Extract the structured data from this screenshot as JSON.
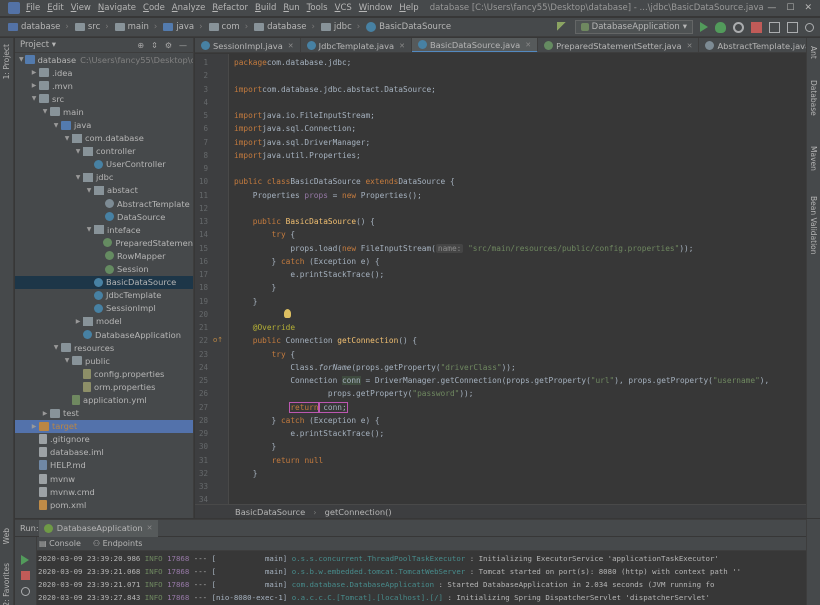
{
  "menubar": {
    "app_icon": "intellij-icon",
    "items": [
      "File",
      "Edit",
      "View",
      "Navigate",
      "Code",
      "Analyze",
      "Refactor",
      "Build",
      "Run",
      "Tools",
      "VCS",
      "Window",
      "Help"
    ],
    "window_title": "database [C:\\Users\\fancy55\\Desktop\\database] - ...\\jdbc\\BasicDataSource.java"
  },
  "navbar": {
    "crumbs": [
      "database",
      "src",
      "main",
      "java",
      "com",
      "database",
      "jdbc",
      "BasicDataSource"
    ],
    "run_config": "DatabaseApplication"
  },
  "left_strip": {
    "top_tab": "1: Project",
    "web_tab": "Web",
    "favorites_tab": "2: Favorites"
  },
  "right_strip": {
    "tabs": [
      "Ant",
      "Database",
      "Maven",
      "Bean Validation"
    ]
  },
  "project": {
    "title": "Project",
    "rows": [
      {
        "indent": 0,
        "arrow": "▼",
        "icon": "folder-blue",
        "label": "database",
        "hint": "C:\\Users\\fancy55\\Desktop\\d"
      },
      {
        "indent": 1,
        "arrow": "▶",
        "icon": "folder",
        "label": ".idea",
        "hint": ""
      },
      {
        "indent": 1,
        "arrow": "▶",
        "icon": "folder",
        "label": ".mvn",
        "hint": ""
      },
      {
        "indent": 1,
        "arrow": "▼",
        "icon": "folder",
        "label": "src",
        "hint": ""
      },
      {
        "indent": 2,
        "arrow": "▼",
        "icon": "folder",
        "label": "main",
        "hint": ""
      },
      {
        "indent": 3,
        "arrow": "▼",
        "icon": "folder-blue",
        "label": "java",
        "hint": ""
      },
      {
        "indent": 4,
        "arrow": "▼",
        "icon": "package",
        "label": "com.database",
        "hint": ""
      },
      {
        "indent": 5,
        "arrow": "▼",
        "icon": "package",
        "label": "controller",
        "hint": ""
      },
      {
        "indent": 6,
        "arrow": "",
        "icon": "class",
        "label": "UserController",
        "hint": ""
      },
      {
        "indent": 5,
        "arrow": "▼",
        "icon": "package",
        "label": "jdbc",
        "hint": ""
      },
      {
        "indent": 6,
        "arrow": "▼",
        "icon": "package",
        "label": "abstact",
        "hint": ""
      },
      {
        "indent": 7,
        "arrow": "",
        "icon": "abstract",
        "label": "AbstractTemplate",
        "hint": ""
      },
      {
        "indent": 7,
        "arrow": "",
        "icon": "class",
        "label": "DataSource",
        "hint": ""
      },
      {
        "indent": 6,
        "arrow": "▼",
        "icon": "package",
        "label": "inteface",
        "hint": ""
      },
      {
        "indent": 7,
        "arrow": "",
        "icon": "interface",
        "label": "PreparedStatemen",
        "hint": ""
      },
      {
        "indent": 7,
        "arrow": "",
        "icon": "interface",
        "label": "RowMapper",
        "hint": ""
      },
      {
        "indent": 7,
        "arrow": "",
        "icon": "interface",
        "label": "Session",
        "hint": ""
      },
      {
        "indent": 6,
        "arrow": "",
        "icon": "class",
        "label": "BasicDataSource",
        "hint": "",
        "selected": true
      },
      {
        "indent": 6,
        "arrow": "",
        "icon": "class",
        "label": "JdbcTemplate",
        "hint": ""
      },
      {
        "indent": 6,
        "arrow": "",
        "icon": "class",
        "label": "SessionImpl",
        "hint": ""
      },
      {
        "indent": 5,
        "arrow": "▶",
        "icon": "package",
        "label": "model",
        "hint": ""
      },
      {
        "indent": 5,
        "arrow": "",
        "icon": "class",
        "label": "DatabaseApplication",
        "hint": ""
      },
      {
        "indent": 3,
        "arrow": "▼",
        "icon": "folder",
        "label": "resources",
        "hint": ""
      },
      {
        "indent": 4,
        "arrow": "▼",
        "icon": "folder",
        "label": "public",
        "hint": ""
      },
      {
        "indent": 5,
        "arrow": "",
        "icon": "props",
        "label": "config.properties",
        "hint": ""
      },
      {
        "indent": 5,
        "arrow": "",
        "icon": "props",
        "label": "orm.properties",
        "hint": ""
      },
      {
        "indent": 4,
        "arrow": "",
        "icon": "yml",
        "label": "application.yml",
        "hint": ""
      },
      {
        "indent": 2,
        "arrow": "▶",
        "icon": "folder",
        "label": "test",
        "hint": ""
      },
      {
        "indent": 1,
        "arrow": "▶",
        "icon": "folder-orange",
        "label": "target",
        "hint": "",
        "selected_light": true
      },
      {
        "indent": 1,
        "arrow": "",
        "icon": "file",
        "label": ".gitignore",
        "hint": ""
      },
      {
        "indent": 1,
        "arrow": "",
        "icon": "file",
        "label": "database.iml",
        "hint": ""
      },
      {
        "indent": 1,
        "arrow": "",
        "icon": "md",
        "label": "HELP.md",
        "hint": ""
      },
      {
        "indent": 1,
        "arrow": "",
        "icon": "file",
        "label": "mvnw",
        "hint": ""
      },
      {
        "indent": 1,
        "arrow": "",
        "icon": "file",
        "label": "mvnw.cmd",
        "hint": ""
      },
      {
        "indent": 1,
        "arrow": "",
        "icon": "xml",
        "label": "pom.xml",
        "hint": ""
      }
    ]
  },
  "editor_tabs": [
    {
      "label": "SessionImpl.java",
      "icon": "class",
      "active": false
    },
    {
      "label": "JdbcTemplate.java",
      "icon": "class",
      "active": false
    },
    {
      "label": "BasicDataSource.java",
      "icon": "class",
      "active": true
    },
    {
      "label": "PreparedStatementSetter.java",
      "icon": "interface",
      "active": false
    },
    {
      "label": "AbstractTemplate.java",
      "icon": "abstract",
      "active": false
    }
  ],
  "editor": {
    "line_numbers": [
      "1",
      "2",
      "3",
      "4",
      "5",
      "6",
      "7",
      "8",
      "9",
      "10",
      "11",
      "12",
      "13",
      "14",
      "15",
      "16",
      "17",
      "18",
      "19",
      "20",
      "21",
      "22",
      "23",
      "24",
      "25",
      "26",
      "27",
      "28",
      "29",
      "30",
      "31",
      "32",
      "33",
      "34",
      "35",
      "36"
    ],
    "lines": [
      [
        [
          "kw",
          "package"
        ],
        [
          "",
          "com.database.jdbc;"
        ]
      ],
      [],
      [
        [
          "kw",
          "import"
        ],
        [
          "",
          "com.database.jdbc.abstact.DataSource;"
        ]
      ],
      [],
      [
        [
          "kw",
          "import"
        ],
        [
          "",
          "java.io.FileInputStream;"
        ]
      ],
      [
        [
          "kw",
          "import"
        ],
        [
          "",
          "java.sql.Connection;"
        ]
      ],
      [
        [
          "kw",
          "import"
        ],
        [
          "",
          "java.sql.DriverManager;"
        ]
      ],
      [
        [
          "kw",
          "import"
        ],
        [
          "",
          "java.util.Properties;"
        ]
      ],
      [],
      [
        [
          "kw",
          "public class"
        ],
        [
          "",
          "BasicDataSource "
        ],
        [
          "kw",
          "extends"
        ],
        [
          "",
          "DataSource {"
        ]
      ],
      [
        [
          "",
          "    Properties "
        ],
        [
          "prop",
          "props"
        ],
        [
          "",
          " = "
        ],
        [
          "kw",
          "new"
        ],
        [
          "",
          " Properties();"
        ]
      ],
      [],
      [
        [
          "",
          "    "
        ],
        [
          "kw",
          "public"
        ],
        [
          "",
          " "
        ],
        [
          "fn",
          "BasicDataSource"
        ],
        [
          "",
          "() {"
        ]
      ],
      [
        [
          "",
          "        "
        ],
        [
          "kw",
          "try"
        ],
        [
          "",
          " {"
        ]
      ],
      [
        [
          "",
          "            props.load("
        ],
        [
          "kw",
          "new"
        ],
        [
          "",
          " FileInputStream("
        ],
        [
          "hint",
          "name:"
        ],
        [
          "",
          " "
        ],
        [
          "str",
          "\"src/main/resources/public/config.properties\""
        ],
        [
          "",
          "));"
        ]
      ],
      [
        [
          "",
          "        } "
        ],
        [
          "kw",
          "catch"
        ],
        [
          "",
          " (Exception e) {"
        ]
      ],
      [
        [
          "",
          "            e.printStackTrace();"
        ]
      ],
      [
        [
          "",
          "        }"
        ]
      ],
      [
        [
          "",
          "    }"
        ]
      ],
      [],
      [
        [
          "",
          "    "
        ],
        [
          "ann",
          "@Override"
        ]
      ],
      [
        [
          "",
          "    "
        ],
        [
          "kw",
          "public"
        ],
        [
          "",
          " Connection "
        ],
        [
          "fn",
          "getConnection"
        ],
        [
          "",
          "() {"
        ]
      ],
      [
        [
          "",
          "        "
        ],
        [
          "kw",
          "try"
        ],
        [
          "",
          " {"
        ]
      ],
      [
        [
          "",
          "            Class."
        ],
        [
          "it",
          "forName"
        ],
        [
          "",
          "(props.getProperty("
        ],
        [
          "str",
          "\"driverClass\""
        ],
        [
          "",
          "));"
        ]
      ],
      [
        [
          "",
          "            Connection "
        ],
        [
          "var",
          "conn"
        ],
        [
          "",
          " = DriverManager.getConnection(props.getProperty("
        ],
        [
          "str",
          "\"url\""
        ],
        [
          "",
          "), props.getProperty("
        ],
        [
          "str",
          "\"username\""
        ],
        [
          "",
          "),"
        ]
      ],
      [
        [
          "",
          "                    props.getProperty("
        ],
        [
          "str",
          "\"password\""
        ],
        [
          "",
          "));"
        ]
      ],
      [
        [
          "",
          "            "
        ],
        [
          "boxkw",
          "return"
        ],
        [
          "box",
          " conn;"
        ]
      ],
      [
        [
          "",
          "        } "
        ],
        [
          "kw",
          "catch"
        ],
        [
          "",
          " (Exception e) {"
        ]
      ],
      [
        [
          "",
          "            e.printStackTrace();"
        ]
      ],
      [
        [
          "",
          "        }"
        ]
      ],
      [
        [
          "",
          "        "
        ],
        [
          "kw",
          "return"
        ],
        [
          "",
          " "
        ],
        [
          "kw",
          "null"
        ],
        [
          ";"
        ]
      ],
      [
        [
          "",
          "    }"
        ]
      ],
      [],
      [],
      [
        [
          "",
          "}"
        ]
      ],
      []
    ]
  },
  "editor_breadcrumb": [
    "BasicDataSource",
    "getConnection()"
  ],
  "run_panel": {
    "label": "Run:",
    "tab": "DatabaseApplication",
    "subtabs": [
      "Console",
      "Endpoints"
    ],
    "logs": [
      {
        "time": "2020-03-09 23:39:20.986",
        "level": "INFO",
        "pid": "17868",
        "sep": "---",
        "thread": "[           main]",
        "logger": "o.s.s.concurrent.ThreadPoolTaskExecutor",
        "msg": ": Initializing ExecutorService 'applicationTaskExecutor'"
      },
      {
        "time": "2020-03-09 23:39:21.068",
        "level": "INFO",
        "pid": "17868",
        "sep": "---",
        "thread": "[           main]",
        "logger": "o.s.b.w.embedded.tomcat.TomcatWebServer",
        "msg": ": Tomcat started on port(s): 8080 (http) with context path ''"
      },
      {
        "time": "2020-03-09 23:39:21.071",
        "level": "INFO",
        "pid": "17868",
        "sep": "---",
        "thread": "[           main]",
        "logger": "com.database.DatabaseApplication",
        "msg": ": Started DatabaseApplication in 2.034 seconds (JVM running fo"
      },
      {
        "time": "2020-03-09 23:39:27.843",
        "level": "INFO",
        "pid": "17868",
        "sep": "---",
        "thread": "[nio-8080-exec-1]",
        "logger": "o.a.c.c.C.[Tomcat].[localhost].[/]",
        "msg": ": Initializing Spring DispatcherServlet 'dispatcherServlet'"
      }
    ]
  },
  "colors": {
    "background": "#2b2b2b",
    "panel": "#3c3f41",
    "keyword": "#cc7832",
    "string": "#6a8759",
    "function": "#ffc66d",
    "annotation": "#bbb529",
    "selection": "#0d293e",
    "highlight_box": "#c24fb5"
  }
}
